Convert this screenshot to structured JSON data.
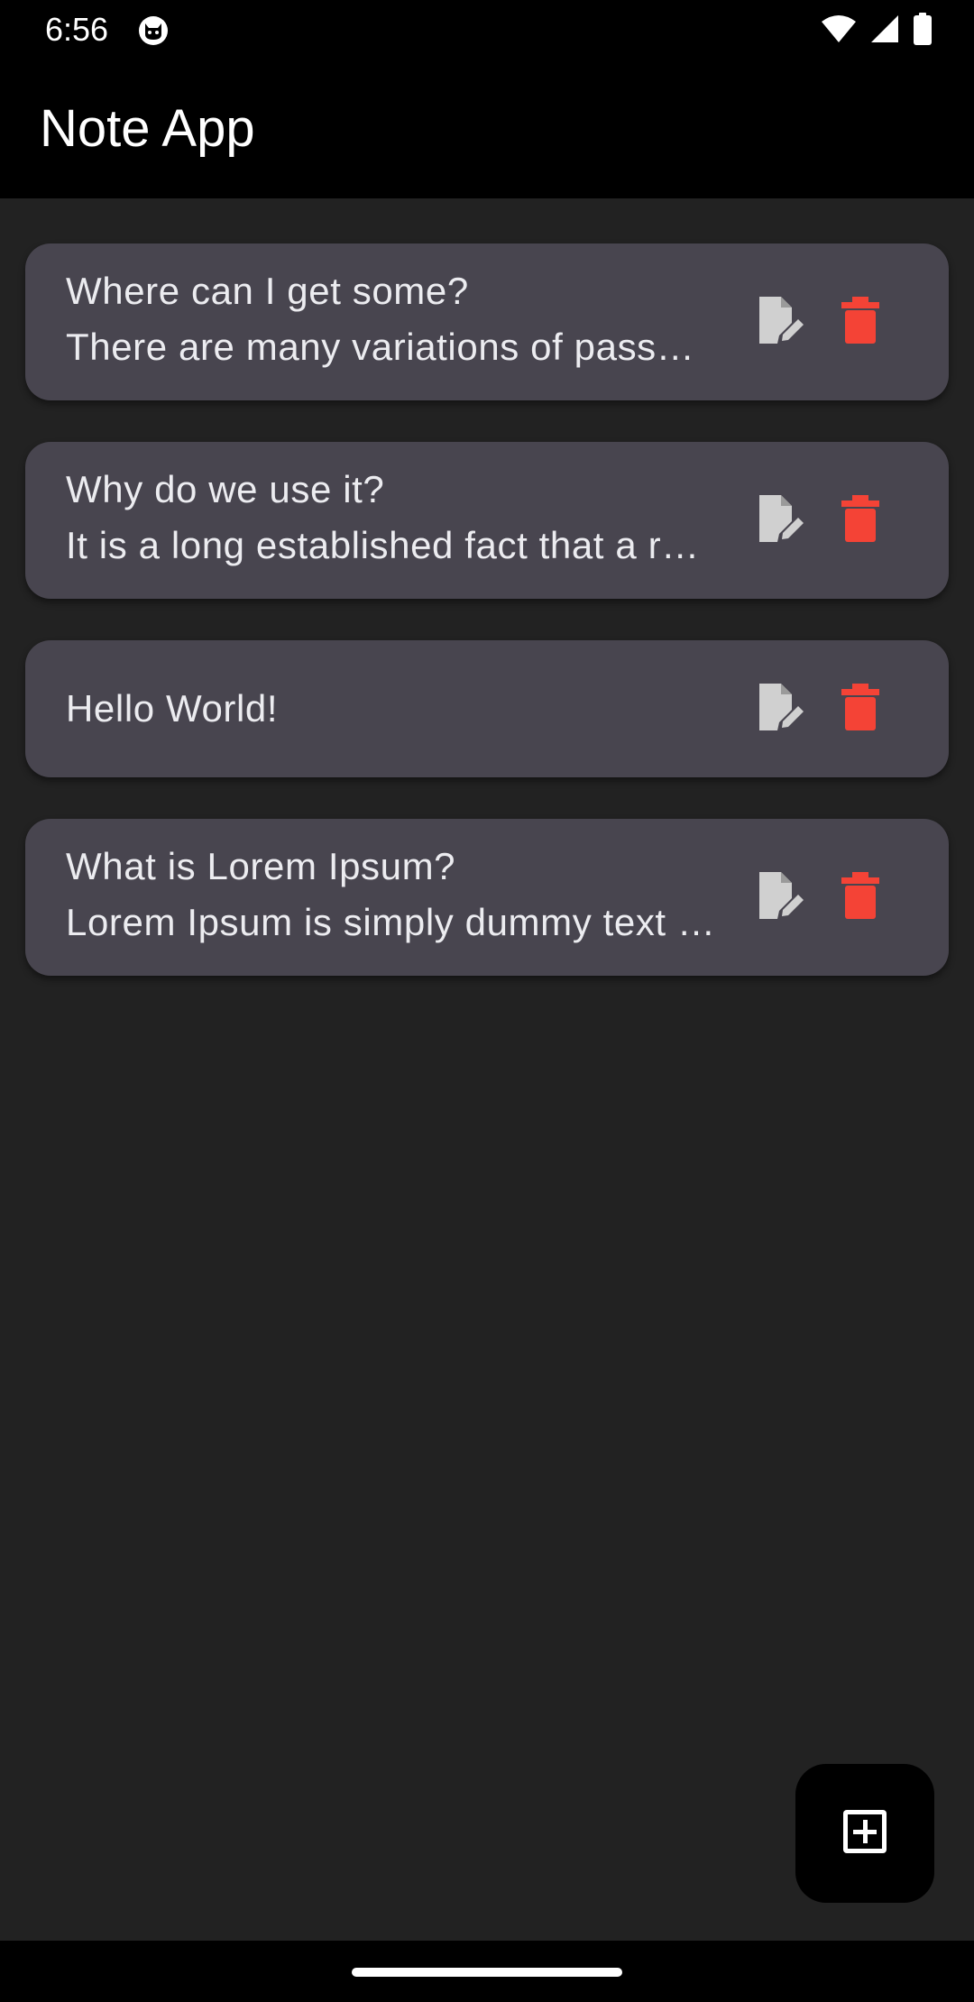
{
  "status_bar": {
    "time": "6:56",
    "icons": [
      "cat-notification-icon",
      "wifi-icon",
      "signal-icon",
      "battery-icon"
    ]
  },
  "app_bar": {
    "title": "Note App"
  },
  "notes": [
    {
      "title": "Where can I get some?",
      "body": "There are many variations of passages of Lorem Ipsum available"
    },
    {
      "title": "Why do we use it?",
      "body": "It is a long established fact that a reader will be distracted"
    },
    {
      "title": "Hello World!",
      "body": ""
    },
    {
      "title": "What is Lorem Ipsum?",
      "body": "Lorem Ipsum is simply dummy text of the printing and typesetting industry"
    }
  ],
  "fab": {
    "icon": "add-box-icon"
  },
  "colors": {
    "background": "#222222",
    "card": "#48454f",
    "bar": "#000000",
    "edit_icon": "#d0d0d0",
    "delete_icon": "#f44336"
  }
}
